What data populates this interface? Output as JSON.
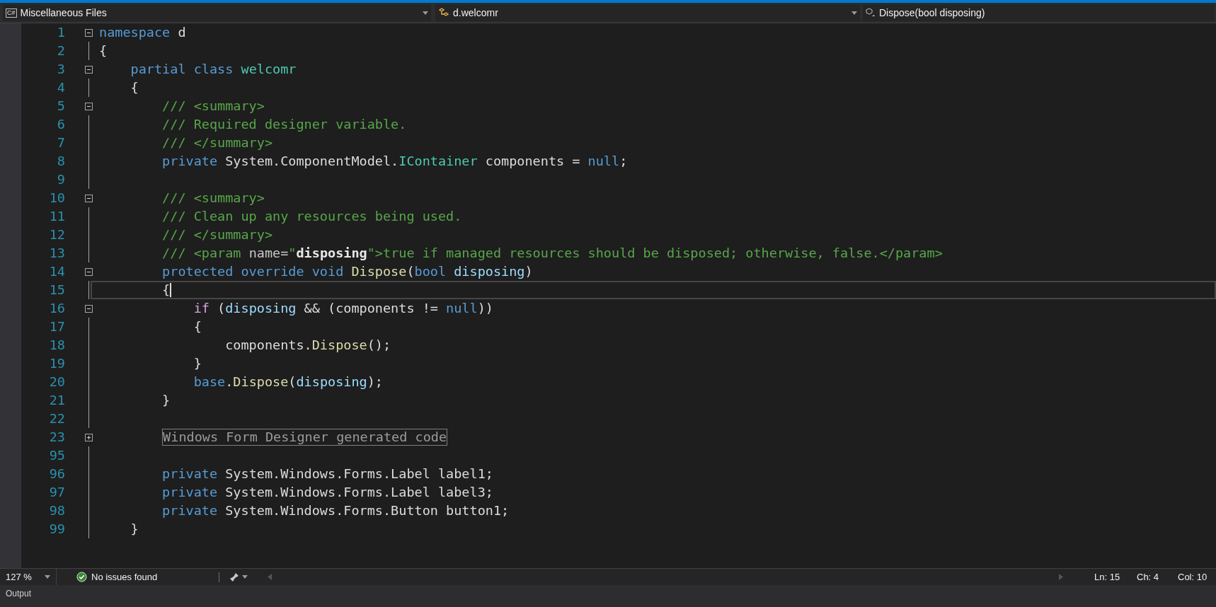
{
  "navbar": {
    "project_icon": "C#",
    "project": "Miscellaneous Files",
    "type": "d.welcomr",
    "member": "Dispose(bool disposing)"
  },
  "editor": {
    "lines": [
      {
        "number": "1",
        "current": false,
        "fold": {
          "expanded": true
        },
        "tokens": [
          {
            "kind": "kw",
            "text": "namespace"
          },
          {
            "kind": "plain",
            "text": " d"
          }
        ]
      },
      {
        "number": "2",
        "current": false,
        "tokens": [
          {
            "kind": "plain",
            "text": "{"
          }
        ]
      },
      {
        "number": "3",
        "current": false,
        "fold": {
          "expanded": true
        },
        "tokens": [
          {
            "kind": "kw",
            "text": "    partial class"
          },
          {
            "kind": "type",
            "text": " welcomr"
          }
        ]
      },
      {
        "number": "4",
        "current": false,
        "tokens": [
          {
            "kind": "plain",
            "text": "    {"
          }
        ]
      },
      {
        "number": "5",
        "current": false,
        "fold": {
          "expanded": true
        },
        "tokens": [
          {
            "kind": "comment",
            "text": "        /// <summary>"
          }
        ]
      },
      {
        "number": "6",
        "current": false,
        "tokens": [
          {
            "kind": "comment",
            "text": "        /// Required designer variable."
          }
        ]
      },
      {
        "number": "7",
        "current": false,
        "tokens": [
          {
            "kind": "comment",
            "text": "        /// </summary>"
          }
        ]
      },
      {
        "number": "8",
        "current": false,
        "tokens": [
          {
            "kind": "kw",
            "text": "        private"
          },
          {
            "kind": "plain",
            "text": " System.ComponentModel."
          },
          {
            "kind": "type",
            "text": "IContainer"
          },
          {
            "kind": "plain",
            "text": " components = "
          },
          {
            "kind": "kw",
            "text": "null"
          },
          {
            "kind": "plain",
            "text": ";"
          }
        ]
      },
      {
        "number": "9",
        "current": false
      },
      {
        "number": "10",
        "current": false,
        "fold": {
          "expanded": true
        },
        "tokens": [
          {
            "kind": "comment",
            "text": "        /// <summary>"
          }
        ]
      },
      {
        "number": "11",
        "current": false,
        "tokens": [
          {
            "kind": "comment",
            "text": "        /// Clean up any resources being used."
          }
        ]
      },
      {
        "number": "12",
        "current": false,
        "tokens": [
          {
            "kind": "comment",
            "text": "        /// </summary>"
          }
        ]
      },
      {
        "number": "13",
        "current": false,
        "tokens": [
          {
            "kind": "comment",
            "text": "        /// <param "
          },
          {
            "kind": "doc-attr",
            "text": "name="
          },
          {
            "kind": "comment",
            "text": "\""
          },
          {
            "kind": "doc-value",
            "text": "disposing"
          },
          {
            "kind": "comment",
            "text": "\">true if managed resources should be disposed; otherwise, false.</param>"
          }
        ]
      },
      {
        "number": "14",
        "current": false,
        "fold": {
          "expanded": true
        },
        "tokens": [
          {
            "kind": "kw",
            "text": "        protected override void"
          },
          {
            "kind": "method",
            "text": " Dispose"
          },
          {
            "kind": "plain",
            "text": "("
          },
          {
            "kind": "kw",
            "text": "bool"
          },
          {
            "kind": "param",
            "text": " disposing"
          },
          {
            "kind": "plain",
            "text": ")"
          }
        ]
      },
      {
        "number": "15",
        "current": true,
        "tokens": [
          {
            "kind": "plain",
            "text": "        {"
          }
        ]
      },
      {
        "number": "16",
        "current": false,
        "fold": {
          "expanded": true
        },
        "tokens": [
          {
            "kind": "control",
            "text": "            if"
          },
          {
            "kind": "plain",
            "text": " ("
          },
          {
            "kind": "param",
            "text": "disposing"
          },
          {
            "kind": "plain",
            "text": " && (components != "
          },
          {
            "kind": "kw",
            "text": "null"
          },
          {
            "kind": "plain",
            "text": "))"
          }
        ]
      },
      {
        "number": "17",
        "current": false,
        "tokens": [
          {
            "kind": "plain",
            "text": "            {"
          }
        ]
      },
      {
        "number": "18",
        "current": false,
        "tokens": [
          {
            "kind": "plain",
            "text": "                components."
          },
          {
            "kind": "method",
            "text": "Dispose"
          },
          {
            "kind": "plain",
            "text": "();"
          }
        ]
      },
      {
        "number": "19",
        "current": false,
        "tokens": [
          {
            "kind": "plain",
            "text": "            }"
          }
        ]
      },
      {
        "number": "20",
        "current": false,
        "tokens": [
          {
            "kind": "kw",
            "text": "            base"
          },
          {
            "kind": "plain",
            "text": "."
          },
          {
            "kind": "method",
            "text": "Dispose"
          },
          {
            "kind": "plain",
            "text": "("
          },
          {
            "kind": "param",
            "text": "disposing"
          },
          {
            "kind": "plain",
            "text": ");"
          }
        ]
      },
      {
        "number": "21",
        "current": false,
        "tokens": [
          {
            "kind": "plain",
            "text": "        }"
          }
        ]
      },
      {
        "number": "22",
        "current": false
      },
      {
        "number": "23",
        "current": false,
        "fold": {
          "expanded": false
        },
        "tokens": [
          {
            "kind": "collapsed",
            "text": "        Windows Form Designer generated code"
          }
        ]
      },
      {
        "number": "95",
        "current": false
      },
      {
        "number": "96",
        "current": false,
        "tokens": [
          {
            "kind": "kw",
            "text": "        private"
          },
          {
            "kind": "plain",
            "text": " System.Windows.Forms.Label label1;"
          }
        ]
      },
      {
        "number": "97",
        "current": false,
        "tokens": [
          {
            "kind": "kw",
            "text": "        private"
          },
          {
            "kind": "plain",
            "text": " System.Windows.Forms.Label label3;"
          }
        ]
      },
      {
        "number": "98",
        "current": false,
        "tokens": [
          {
            "kind": "kw",
            "text": "        private"
          },
          {
            "kind": "plain",
            "text": " System.Windows.Forms.Button button1;"
          }
        ]
      },
      {
        "number": "99",
        "current": false,
        "tokens": [
          {
            "kind": "plain",
            "text": "    }"
          }
        ]
      }
    ]
  },
  "status_bar": {
    "zoom": "127 %",
    "issues": "No issues found",
    "line": "Ln: 15",
    "char": "Ch: 4",
    "column": "Col: 10"
  },
  "output_panel": {
    "title": "Output"
  }
}
